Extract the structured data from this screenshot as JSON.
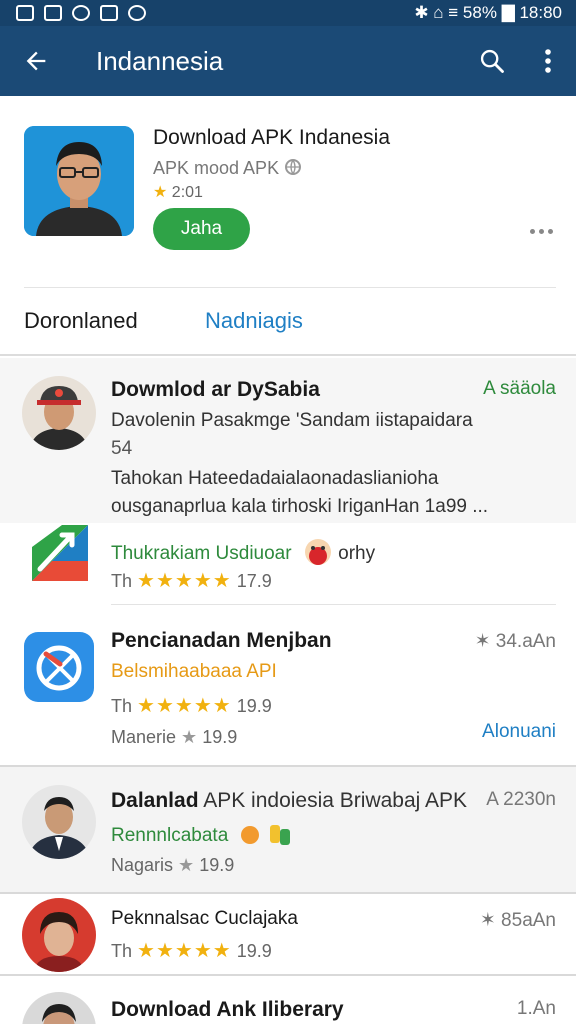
{
  "status_bar": {
    "right_text": "✱ ⌂ ≡ 58% ▇ 18:80"
  },
  "appbar": {
    "title": "Indannesia"
  },
  "header": {
    "title": "Download APK Indanesia",
    "subtitle": "APK mood APK",
    "rating": "2:01",
    "button_label": "Jaha"
  },
  "tabs": [
    {
      "label": "Doronlaned"
    },
    {
      "label": "Nadniagis"
    }
  ],
  "list": {
    "item1": {
      "title": "Dowmlod ar DySabia",
      "right": "A sääola",
      "desc1": "Davolenin Pasakmge 'Sandam iistapaidara",
      "desc2": "54",
      "desc3": "Tahokan Hateedadaialaonadaslianioha",
      "desc4": "ousganaprlua kala tirhoski IriganHan 1a99 ..."
    },
    "item2": {
      "subtitle": "Thukrakiam Usdiuoar",
      "subtitle_extra": "orhy",
      "rating_prefix": "Th",
      "stars": "★★★★★",
      "rating": "17.9"
    },
    "item3": {
      "title": "Pencianadan Menjban",
      "right": "✶ 34.aAn",
      "subtitle": "Belsmihaabaaa API",
      "rating_prefix": "Th",
      "stars": "★★★★★",
      "rating": "19.9",
      "line3_prefix": "Manerie",
      "line3_star": "★",
      "line3_value": "19.9",
      "link": "Alonuani"
    },
    "item4": {
      "title_bold": "Dalanlad",
      "title_rest": " APK indoiesia Briwabaj APK",
      "right": "A 2230n",
      "subtitle": "Rennnlcabata",
      "line3_prefix": "Nagaris",
      "line3_star": "★",
      "line3_value": "19.9"
    },
    "item5": {
      "title": "Peknnalsac Cuclajaka",
      "right": "✶ 85aAn",
      "rating_prefix": "Th",
      "stars": "★★★★★",
      "rating": "19.9"
    },
    "item6": {
      "title": "Download Ank Iliberary",
      "right": "1.An"
    }
  },
  "colors": {
    "appbar": "#1b4a76",
    "statusbar": "#17426a",
    "accent_blue": "#1f7fc4",
    "install_green": "#2fa347",
    "star": "#f1b10f"
  }
}
